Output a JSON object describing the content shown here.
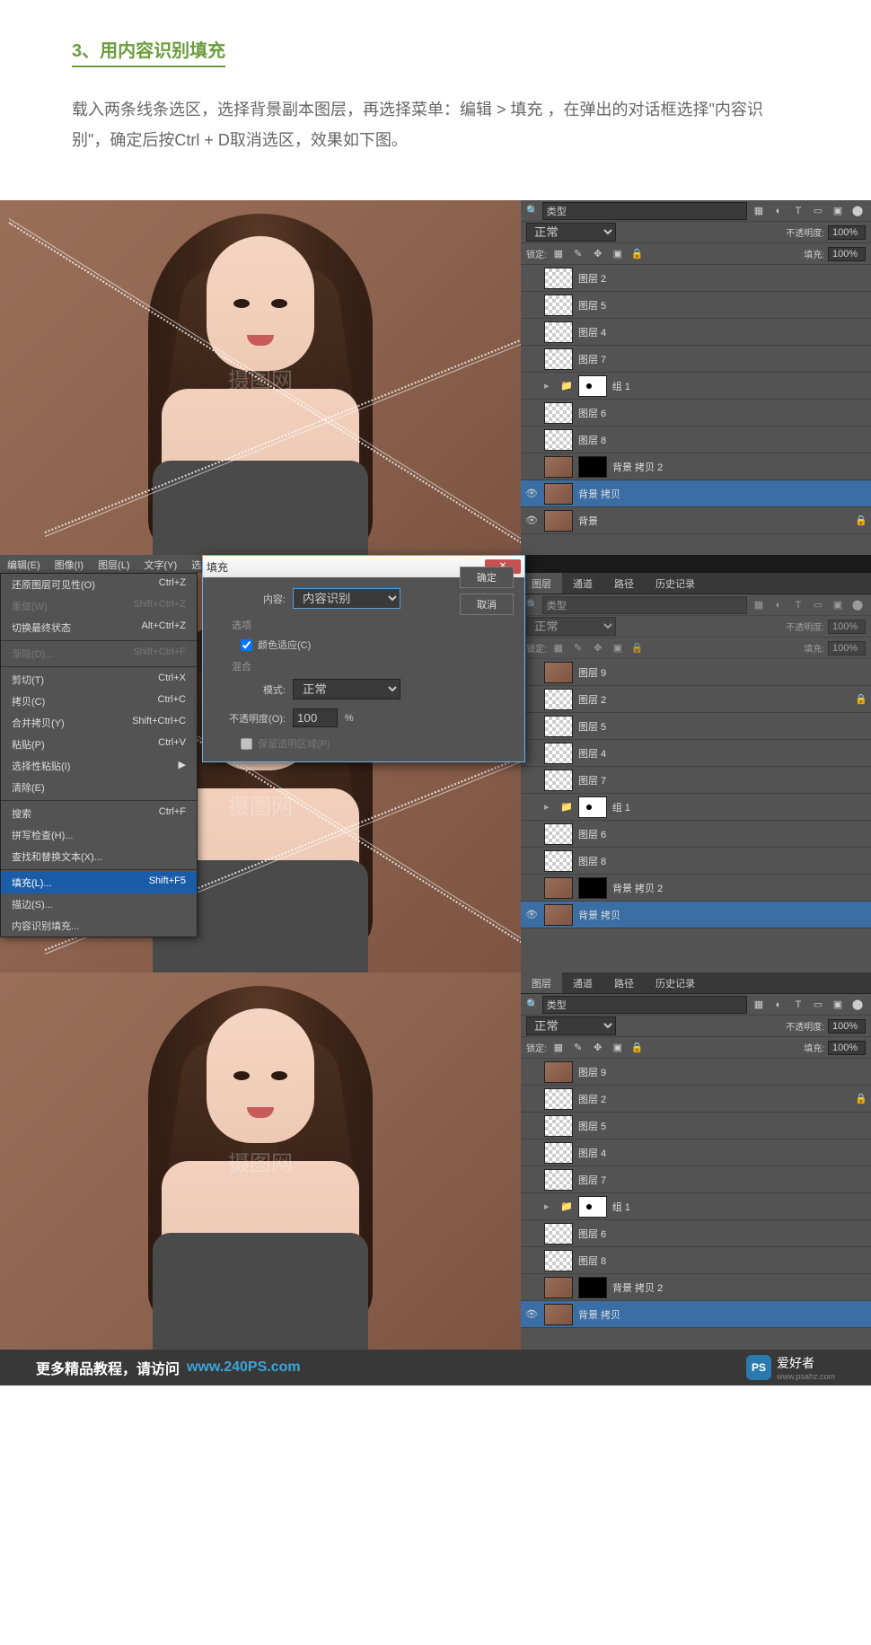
{
  "article": {
    "step_title": "3、用内容识别填充",
    "step_desc": "载入两条线条选区，选择背景副本图层，再选择菜单：编辑 > 填充 ，在弹出的对话框选择\"内容识别\"，确定后按Ctrl + D取消选区，效果如下图。"
  },
  "watermark": "摄图网",
  "layers_panel": {
    "tabs": [
      "图层",
      "通道",
      "路径",
      "历史记录"
    ],
    "filter_prefix": "🔍",
    "filter_label": "类型",
    "blend_mode": "正常",
    "opacity_label": "不透明度:",
    "opacity_value": "100%",
    "lock_label": "锁定:",
    "fill_label": "填充:",
    "fill_value": "100%",
    "layers": [
      {
        "vis": "",
        "name": "图层 2",
        "thumb": "checker",
        "locked": false
      },
      {
        "vis": "",
        "name": "图层 5",
        "thumb": "checker",
        "locked": false
      },
      {
        "vis": "",
        "name": "图层 4",
        "thumb": "checker",
        "locked": false
      },
      {
        "vis": "",
        "name": "图层 7",
        "thumb": "checker",
        "locked": false
      },
      {
        "vis": "",
        "name": "组 1",
        "thumb": "group",
        "mask": "white",
        "locked": false,
        "group": true
      },
      {
        "vis": "",
        "name": "图层 6",
        "thumb": "checker",
        "locked": false
      },
      {
        "vis": "",
        "name": "图层 8",
        "thumb": "checker",
        "locked": false
      },
      {
        "vis": "",
        "name": "背景 拷贝 2",
        "thumb": "img",
        "mask": "black",
        "locked": false
      },
      {
        "vis": "👁",
        "name": "背景 拷贝",
        "thumb": "img",
        "locked": false,
        "selected": true
      },
      {
        "vis": "👁",
        "name": "背景",
        "thumb": "img",
        "locked": true
      }
    ],
    "layers2": [
      {
        "vis": "",
        "name": "图层 9",
        "thumb": "img"
      },
      {
        "vis": "",
        "name": "图层 2",
        "thumb": "checker",
        "locked": true
      },
      {
        "vis": "",
        "name": "图层 5",
        "thumb": "checker"
      },
      {
        "vis": "",
        "name": "图层 4",
        "thumb": "checker"
      },
      {
        "vis": "",
        "name": "图层 7",
        "thumb": "checker"
      },
      {
        "vis": "",
        "name": "组 1",
        "thumb": "group",
        "mask": "white",
        "group": true
      },
      {
        "vis": "",
        "name": "图层 6",
        "thumb": "checker"
      },
      {
        "vis": "",
        "name": "图层 8",
        "thumb": "checker"
      },
      {
        "vis": "",
        "name": "背景 拷贝 2",
        "thumb": "img",
        "mask": "black"
      },
      {
        "vis": "👁",
        "name": "背景 拷贝",
        "thumb": "img",
        "selected": true
      }
    ],
    "layers3": [
      {
        "vis": "",
        "name": "图层 9",
        "thumb": "img"
      },
      {
        "vis": "",
        "name": "图层 2",
        "thumb": "checker",
        "locked": true
      },
      {
        "vis": "",
        "name": "图层 5",
        "thumb": "checker"
      },
      {
        "vis": "",
        "name": "图层 4",
        "thumb": "checker"
      },
      {
        "vis": "",
        "name": "图层 7",
        "thumb": "checker"
      },
      {
        "vis": "",
        "name": "组 1",
        "thumb": "group",
        "mask": "white",
        "group": true
      },
      {
        "vis": "",
        "name": "图层 6",
        "thumb": "checker"
      },
      {
        "vis": "",
        "name": "图层 8",
        "thumb": "checker"
      },
      {
        "vis": "",
        "name": "背景 拷贝 2",
        "thumb": "img",
        "mask": "black"
      },
      {
        "vis": "👁",
        "name": "背景 拷贝",
        "thumb": "img",
        "selected": true
      }
    ]
  },
  "menubar": [
    "编辑(E)",
    "图像(I)",
    "图层(L)",
    "文字(Y)",
    "选"
  ],
  "edit_menu": [
    {
      "label": "还原图层可见性(O)",
      "shortcut": "Ctrl+Z"
    },
    {
      "label": "重做(W)",
      "shortcut": "Shift+Ctrl+Z",
      "disabled": true
    },
    {
      "label": "切换最终状态",
      "shortcut": "Alt+Ctrl+Z"
    },
    {
      "sep": true
    },
    {
      "label": "渐隐(D)...",
      "shortcut": "Shift+Ctrl+F",
      "disabled": true
    },
    {
      "sep": true
    },
    {
      "label": "剪切(T)",
      "shortcut": "Ctrl+X"
    },
    {
      "label": "拷贝(C)",
      "shortcut": "Ctrl+C"
    },
    {
      "label": "合并拷贝(Y)",
      "shortcut": "Shift+Ctrl+C"
    },
    {
      "label": "粘贴(P)",
      "shortcut": "Ctrl+V"
    },
    {
      "label": "选择性粘贴(I)",
      "shortcut": "▶"
    },
    {
      "label": "清除(E)",
      "shortcut": ""
    },
    {
      "sep": true
    },
    {
      "label": "搜索",
      "shortcut": "Ctrl+F"
    },
    {
      "label": "拼写检查(H)...",
      "shortcut": ""
    },
    {
      "label": "查找和替换文本(X)...",
      "shortcut": ""
    },
    {
      "sep": true
    },
    {
      "label": "填充(L)...",
      "shortcut": "Shift+F5",
      "selected": true
    },
    {
      "label": "描边(S)...",
      "shortcut": ""
    },
    {
      "label": "内容识别填充...",
      "shortcut": ""
    }
  ],
  "fill_dialog": {
    "title": "填充",
    "content_label": "内容:",
    "content_value": "内容识别",
    "ok": "确定",
    "cancel": "取消",
    "options_group": "选项",
    "color_adapt": "颜色适应(C)",
    "blend_group": "混合",
    "mode_label": "模式:",
    "mode_value": "正常",
    "opacity_label": "不透明度(O):",
    "opacity_value": "100",
    "opacity_unit": "%",
    "preserve_trans": "保留透明区域(P)"
  },
  "footer": {
    "text": "更多精品教程，请访问",
    "link": "www.240PS.com",
    "logo_badge": "PS",
    "logo_text": "爱好者",
    "logo_url": "www.psahz.com"
  }
}
